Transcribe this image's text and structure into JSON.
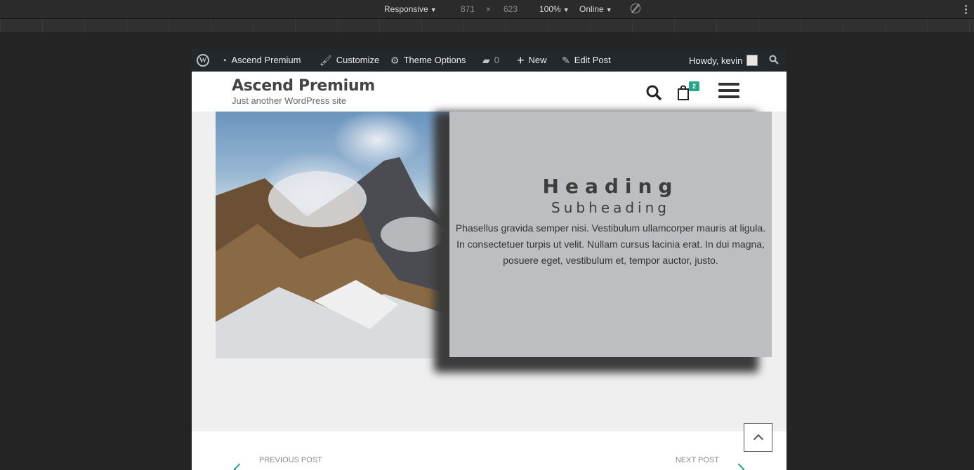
{
  "devtools": {
    "device": "Responsive",
    "width": "871",
    "times": "×",
    "height": "623",
    "zoom": "100%",
    "network": "Online"
  },
  "adminbar": {
    "site": "Ascend Premium",
    "customize": "Customize",
    "theme_options": "Theme Options",
    "comments_count": "0",
    "new": "New",
    "edit_post": "Edit Post",
    "howdy": "Howdy, kevin"
  },
  "header": {
    "title": "Ascend Premium",
    "tagline": "Just another WordPress site",
    "cart_count": "2"
  },
  "hero": {
    "heading": "Heading",
    "subheading": "Subheading",
    "body": "Phasellus gravida semper nisi. Vestibulum ullamcorper mauris at ligula. In consectetuer turpis ut velit. Nullam cursus lacinia erat. In dui magna, posuere eget, vestibulum et, tempor auctor, justo."
  },
  "post_nav": {
    "previous": "PREVIOUS POST",
    "next": "NEXT POST"
  }
}
